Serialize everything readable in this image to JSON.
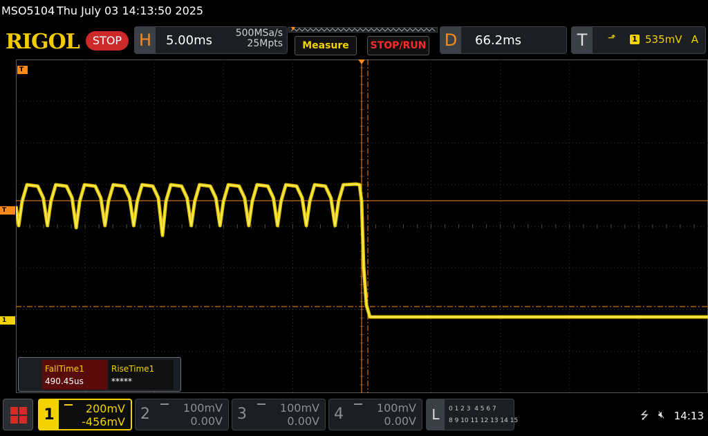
{
  "title_bar": {
    "model": "MSO5104",
    "datetime": "Thu July 03 14:13:50 2025"
  },
  "header": {
    "logo": "RIGOL",
    "status": "STOP",
    "horizontal": {
      "key": "H",
      "timebase": "5.00ms",
      "sample_rate": "500MSa/s",
      "memory_depth": "25Mpts"
    },
    "buttons": {
      "measure": "Measure",
      "stop_run": "STOP/RUN"
    },
    "delay": {
      "key": "D",
      "value": "66.2ms"
    },
    "trigger": {
      "key": "T",
      "slope_icon": "rising-edge-icon",
      "source": "1",
      "level": "535mV",
      "mode": "A"
    }
  },
  "screen": {
    "markers": {
      "trigger_time": "T",
      "trigger_level": "T",
      "channel1": "1"
    },
    "grid_divisions": {
      "horizontal": 10,
      "vertical": 8
    }
  },
  "measurements": [
    {
      "name": "FallTime1",
      "value": "490.45us"
    },
    {
      "name": "RiseTime1",
      "value": "*****"
    }
  ],
  "channels": [
    {
      "num": "1",
      "scale": "200mV",
      "offset": "-456mV",
      "active": true
    },
    {
      "num": "2",
      "scale": "100mV",
      "offset": "0.00V",
      "active": false
    },
    {
      "num": "3",
      "scale": "100mV",
      "offset": "0.00V",
      "active": false
    },
    {
      "num": "4",
      "scale": "100mV",
      "offset": "0.00V",
      "active": false
    }
  ],
  "logic": {
    "key": "L",
    "row1": "0 1 2 3  4 5 6 7",
    "row2": "8 9 10 11 12 13 14 15"
  },
  "system": {
    "usb_icon": "usb-icon",
    "speaker_icon": "speaker-muted-icon",
    "clock": "14:13"
  },
  "colors": {
    "ch1": "#f2d200",
    "trigger": "#ff8a1a",
    "stop": "#cc2a2a",
    "background": "#000000"
  }
}
